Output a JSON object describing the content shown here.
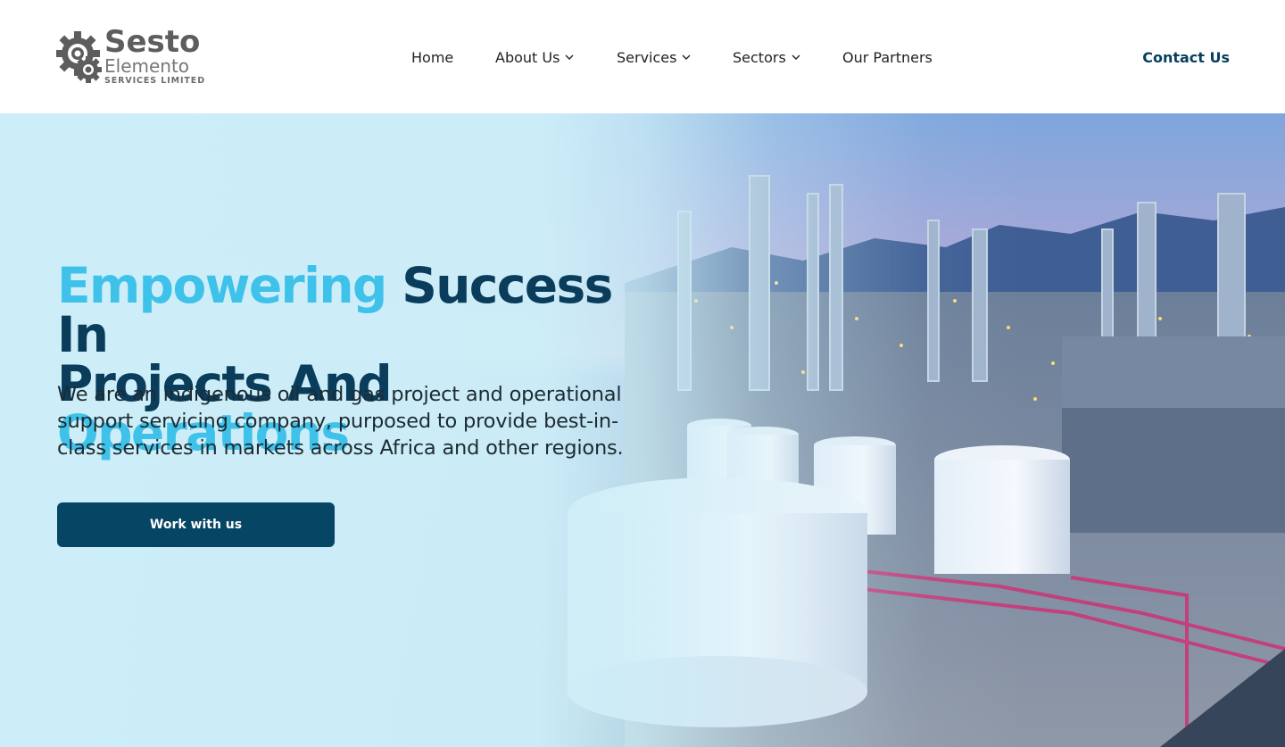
{
  "brand": {
    "name_line1": "Sesto",
    "name_line2": "Elemento",
    "name_line3": "SERVICES LIMITED",
    "logo_icon": "gears-icon",
    "colors": {
      "gear": "#5d5d5d",
      "text": "#5d5d5d"
    }
  },
  "nav": {
    "items": [
      {
        "label": "Home",
        "has_dropdown": false
      },
      {
        "label": "About Us",
        "has_dropdown": true
      },
      {
        "label": "Services",
        "has_dropdown": true
      },
      {
        "label": "Sectors",
        "has_dropdown": true
      },
      {
        "label": "Our Partners",
        "has_dropdown": false
      }
    ],
    "contact_label": "Contact Us",
    "dropdown_icon": "chevron-down-icon"
  },
  "hero": {
    "title_word1": "Empowering",
    "title_rest1": " Success In",
    "title_line2_a": "Projects And ",
    "title_line2_b": "Operations",
    "subtitle": "We are an indigenous oil and gas project and operational support servicing company, purposed to provide best-in-class services in markets across Africa and other regions.",
    "cta_label": "Work with us",
    "background": "oil-refinery-photo"
  },
  "colors": {
    "primary": "#064664",
    "accent": "#3fc2ea",
    "hero_bg": "#cdeef7",
    "contact": "#06405f"
  }
}
